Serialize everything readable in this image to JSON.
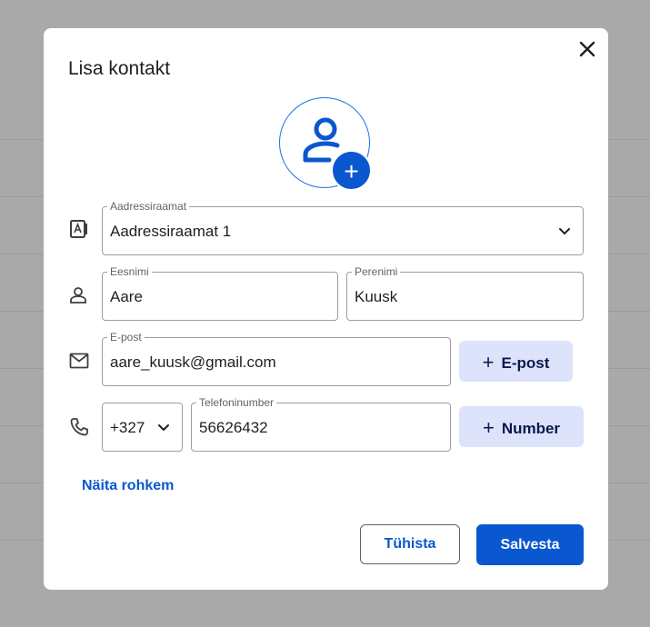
{
  "dialog": {
    "title": "Lisa kontakt",
    "close_icon": "close-icon",
    "avatar_icon": "add-person-icon"
  },
  "address_book": {
    "label": "Aadressiraamat",
    "value": "Aadressiraamat 1",
    "icon": "address-book-icon"
  },
  "name": {
    "icon": "person-icon",
    "first_label": "Eesnimi",
    "first_value": "Aare",
    "last_label": "Perenimi",
    "last_value": "Kuusk"
  },
  "email": {
    "icon": "mail-icon",
    "label": "E-post",
    "value": "aare_kuusk@gmail.com",
    "add_label": "E-post"
  },
  "phone": {
    "icon": "phone-icon",
    "country_code": "+327",
    "label": "Telefoninumber",
    "value": "56626432",
    "add_label": "Number"
  },
  "more_link": "Näita rohkem",
  "actions": {
    "cancel": "Tühista",
    "save": "Salvesta"
  },
  "colors": {
    "accent": "#0b57d0",
    "tonal_button": "#dde3fb",
    "backdrop": "#a9a9a9"
  }
}
